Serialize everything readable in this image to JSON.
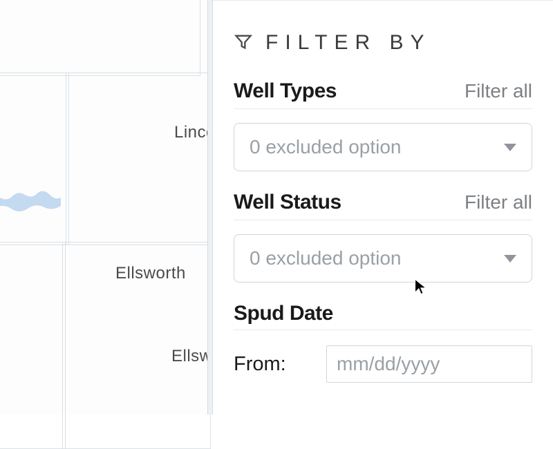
{
  "map": {
    "labels": {
      "lincoln": "Linco",
      "ellsworth1": "Ellsworth",
      "ellsworth2": "Ellswo"
    }
  },
  "panel": {
    "header": "FILTER BY",
    "sections": {
      "wellTypes": {
        "title": "Well Types",
        "filterAll": "Filter all",
        "selectText": "0 excluded option"
      },
      "wellStatus": {
        "title": "Well Status",
        "filterAll": "Filter all",
        "selectText": "0 excluded option"
      },
      "spudDate": {
        "title": "Spud Date",
        "fromLabel": "From:",
        "fromPlaceholder": "mm/dd/yyyy"
      }
    }
  }
}
